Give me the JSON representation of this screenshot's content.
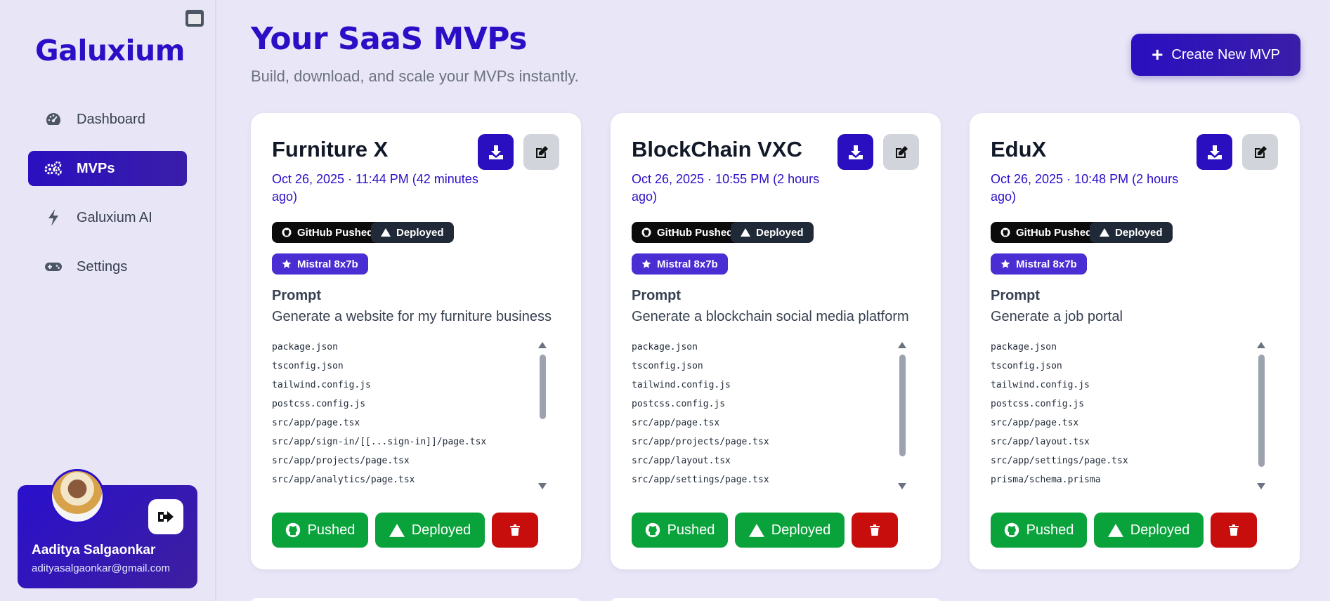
{
  "sidebar": {
    "logo": "Galuxium",
    "nav": [
      {
        "label": "Dashboard",
        "icon": "gauge-icon",
        "active": false
      },
      {
        "label": "MVPs",
        "icon": "gears-icon",
        "active": true
      },
      {
        "label": "Galuxium AI",
        "icon": "bolt-icon",
        "active": false
      },
      {
        "label": "Settings",
        "icon": "gamepad-icon",
        "active": false
      }
    ],
    "user": {
      "name": "Aaditya Salgaonkar",
      "email": "adityasalgaonkar@gmail.com"
    }
  },
  "header": {
    "title": "Your SaaS MVPs",
    "subtitle": "Build, download, and scale your MVPs instantly.",
    "create_label": "Create New MVP"
  },
  "badges": {
    "github": "GitHub Pushed",
    "deployed": "Deployed"
  },
  "prompt_label": "Prompt",
  "actions": {
    "pushed": "Pushed",
    "deployed": "Deployed"
  },
  "cards": [
    {
      "title": "Furniture X",
      "date": "Oct 26, 2025 · 11:44 PM  (42 minutes ago)",
      "model": "Mistral 8x7b",
      "prompt": "Generate a website for my furniture business",
      "files": [
        "package.json",
        "tsconfig.json",
        "tailwind.config.js",
        "postcss.config.js",
        "src/app/page.tsx",
        "src/app/sign-in/[[...sign-in]]/page.tsx",
        "src/app/projects/page.tsx",
        "src/app/analytics/page.tsx"
      ]
    },
    {
      "title": "BlockChain VXC",
      "date": "Oct 26, 2025 · 10:55 PM  (2 hours ago)",
      "model": "Mistral 8x7b",
      "prompt": "Generate a blockchain social media platform",
      "files": [
        "package.json",
        "tsconfig.json",
        "tailwind.config.js",
        "postcss.config.js",
        "src/app/page.tsx",
        "src/app/projects/page.tsx",
        "src/app/layout.tsx",
        "src/app/settings/page.tsx"
      ]
    },
    {
      "title": "EduX",
      "date": "Oct 26, 2025 · 10:48 PM  (2 hours ago)",
      "model": "Mistral 8x7b",
      "prompt": "Generate a job portal",
      "files": [
        "package.json",
        "tsconfig.json",
        "tailwind.config.js",
        "postcss.config.js",
        "src/app/page.tsx",
        "src/app/layout.tsx",
        "src/app/settings/page.tsx",
        "prisma/schema.prisma"
      ]
    }
  ]
}
